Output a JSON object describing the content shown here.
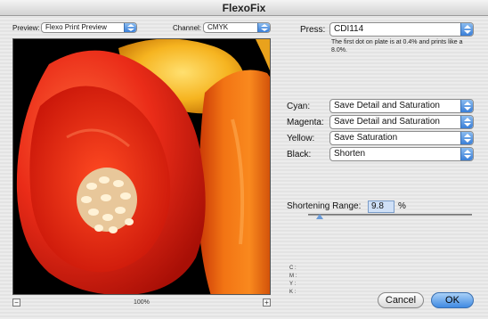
{
  "window": {
    "title": "FlexoFix"
  },
  "preview_bar": {
    "preview_label": "Preview:",
    "preview_value": "Flexo Print Preview",
    "channel_label": "Channel:",
    "channel_value": "CMYK"
  },
  "press": {
    "label": "Press:",
    "value": "CDI114",
    "note": "The first dot on plate is at 0.4% and prints like a 8.0%."
  },
  "channels": [
    {
      "label": "Cyan:",
      "value": "Save Detail and Saturation"
    },
    {
      "label": "Magenta:",
      "value": "Save Detail and Saturation"
    },
    {
      "label": "Yellow:",
      "value": "Save Saturation"
    },
    {
      "label": "Black:",
      "value": "Shorten"
    }
  ],
  "shortening": {
    "label": "Shortening Range:",
    "value": "9.8",
    "unit": "%",
    "slider_fraction": 0.07
  },
  "readout": {
    "c": "C :",
    "m": "M :",
    "y": "Y :",
    "k": "K :"
  },
  "zoom": {
    "minus": "−",
    "plus": "+",
    "level": "100%"
  },
  "buttons": {
    "cancel": "Cancel",
    "ok": "OK"
  },
  "colors": {
    "accent": "#3f8ae2",
    "pepper_red": "#e8281a",
    "pepper_orange": "#f06a10",
    "pepper_yellow": "#f5b321"
  }
}
